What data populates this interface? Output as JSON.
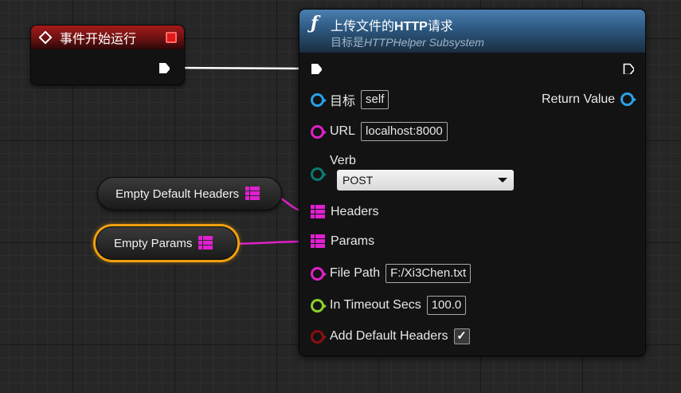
{
  "colors": {
    "event_header": "#a51a1a",
    "function_header": "#3a6b97",
    "object_pin": "#2aa0e8",
    "string_pin": "#e020c8",
    "enum_pin": "#0a7a70",
    "float_pin": "#8ad12a",
    "bool_pin": "#8a1010",
    "map_pin": "#e020d0",
    "selection": "#f0a010"
  },
  "event_node": {
    "title": "事件开始运行",
    "icons": [
      "event-diamond-icon",
      "delegate-square-icon",
      "exec-out-icon"
    ]
  },
  "function_node": {
    "icon": "function-f-icon",
    "title_prefix": "上传文件的",
    "title_bold": "HTTP",
    "title_suffix": "请求",
    "subtitle_prefix": "目标是",
    "subtitle_italic": "HTTPHelper Subsystem",
    "pins": {
      "target": {
        "label": "目标",
        "value": "self"
      },
      "return_value": {
        "label": "Return Value"
      },
      "url": {
        "label": "URL",
        "value": "localhost:8000"
      },
      "verb": {
        "label": "Verb",
        "value": "POST"
      },
      "headers": {
        "label": "Headers"
      },
      "params": {
        "label": "Params"
      },
      "file_path": {
        "label": "File Path",
        "value": "F:/Xi3Chen.txt"
      },
      "timeout": {
        "label": "In Timeout Secs",
        "value": "100.0"
      },
      "add_default_headers": {
        "label": "Add Default Headers",
        "checked": true,
        "check_glyph": "✓"
      }
    }
  },
  "empty_headers_node": {
    "label": "Empty Default Headers"
  },
  "empty_params_node": {
    "label": "Empty Params"
  }
}
